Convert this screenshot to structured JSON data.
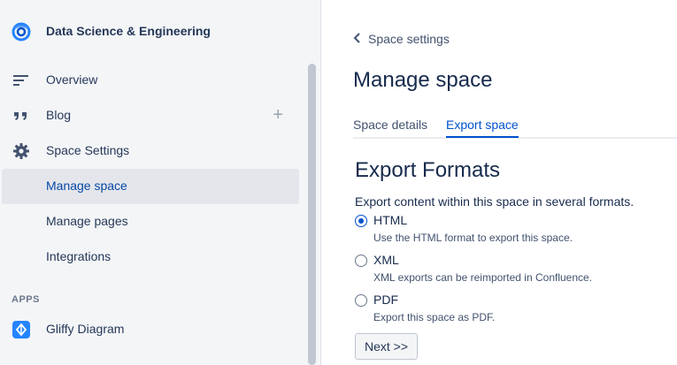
{
  "sidebar": {
    "space_name": "Data Science & Engineering",
    "items": [
      {
        "label": "Overview",
        "icon": "lines-icon"
      },
      {
        "label": "Blog",
        "icon": "quote-icon",
        "action": "+"
      },
      {
        "label": "Space Settings",
        "icon": "gear-icon"
      },
      {
        "label": "Manage space",
        "active": true
      },
      {
        "label": "Manage pages"
      },
      {
        "label": "Integrations"
      }
    ],
    "apps_label": "APPS",
    "apps": [
      {
        "label": "Gliffy Diagram",
        "icon": "gliffy-icon"
      }
    ]
  },
  "main": {
    "breadcrumb": "Space settings",
    "title": "Manage space",
    "tabs": [
      {
        "label": "Space details",
        "active": false
      },
      {
        "label": "Export space",
        "active": true
      }
    ],
    "section_title": "Export Formats",
    "section_desc": "Export content within this space in several formats.",
    "options": [
      {
        "label": "HTML",
        "help": "Use the HTML format to export this space.",
        "checked": true
      },
      {
        "label": "XML",
        "help": "XML exports can be reimported in Confluence.",
        "checked": false
      },
      {
        "label": "PDF",
        "help": "Export this space as PDF.",
        "checked": false
      }
    ],
    "next_button": "Next >>"
  },
  "colors": {
    "accent": "#0052cc",
    "sidebar_bg": "#f4f5f7",
    "active_bg": "#e4e6eb"
  }
}
